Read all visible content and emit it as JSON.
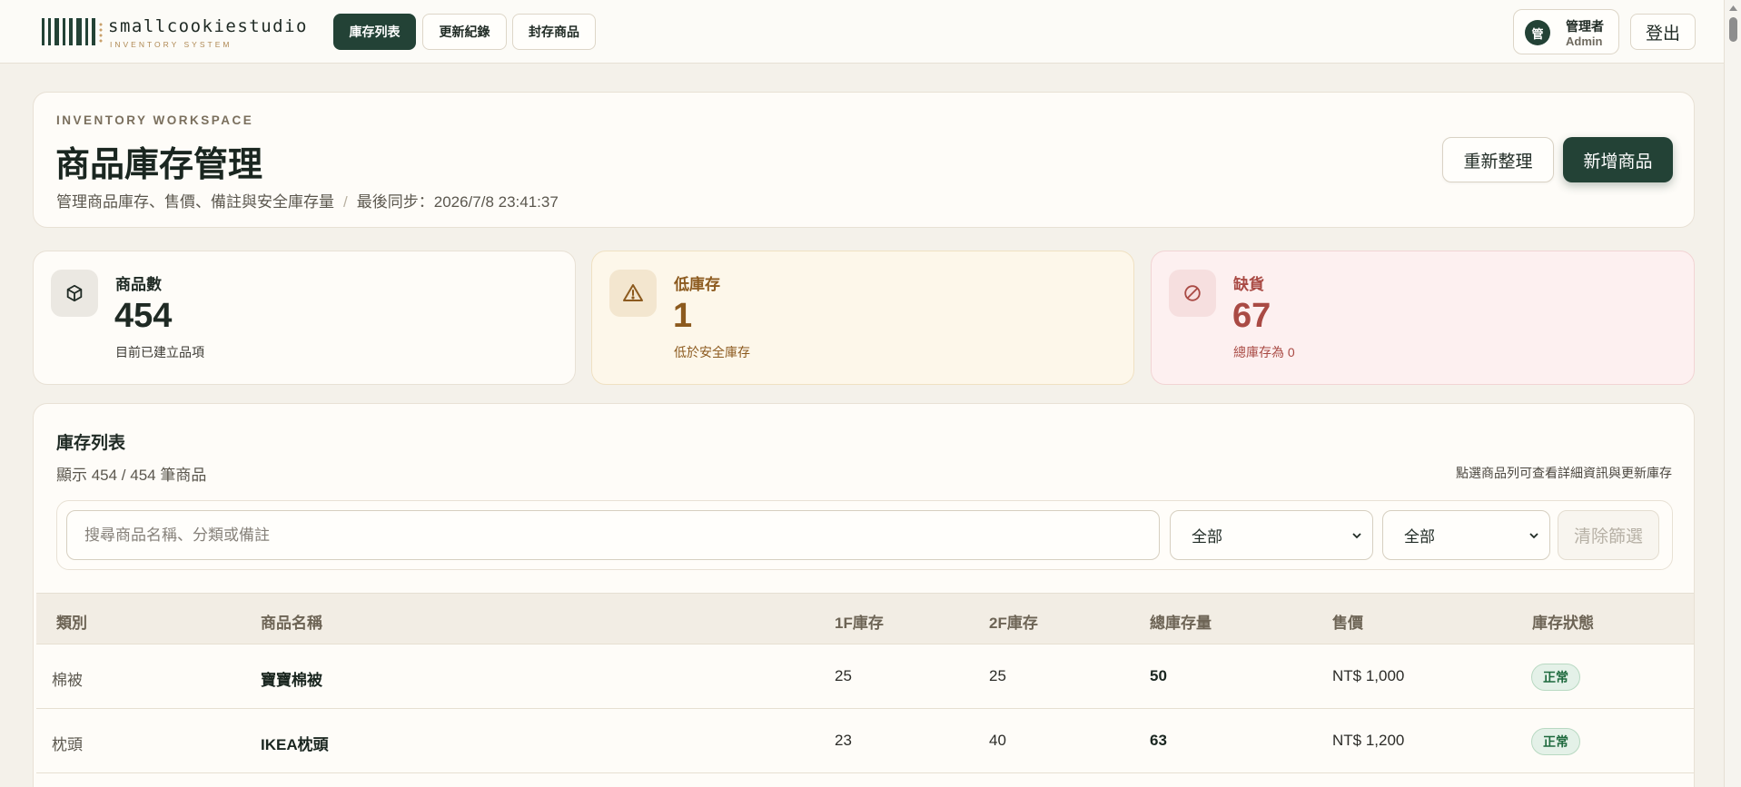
{
  "brand": {
    "name": "smallcookiestudio",
    "subtitle": "INVENTORY SYSTEM"
  },
  "nav": {
    "tabs": [
      {
        "label": "庫存列表",
        "active": true
      },
      {
        "label": "更新紀錄",
        "active": false
      },
      {
        "label": "封存商品",
        "active": false
      }
    ]
  },
  "user": {
    "avatar": "管",
    "role": "管理者",
    "name": "Admin",
    "logout_label": "登出"
  },
  "header": {
    "eyebrow": "INVENTORY WORKSPACE",
    "title": "商品庫存管理",
    "description": "管理商品庫存、售價、備註與安全庫存量",
    "separator": "/",
    "last_sync": "最後同步：2026/7/8 23:41:37",
    "refresh_label": "重新整理",
    "add_label": "新增商品"
  },
  "stats": [
    {
      "label": "商品數",
      "value": "454",
      "sub": "目前已建立品項",
      "icon": "box-icon"
    },
    {
      "label": "低庫存",
      "value": "1",
      "sub": "低於安全庫存",
      "icon": "warning-icon"
    },
    {
      "label": "缺貨",
      "value": "67",
      "sub": "總庫存為 0",
      "icon": "ban-icon"
    }
  ],
  "list": {
    "title": "庫存列表",
    "count": "顯示 454 / 454 筆商品",
    "hint": "點選商品列可查看詳細資訊與更新庫存",
    "search_placeholder": "搜尋商品名稱、分類或備註",
    "filter_category": "全部",
    "filter_status": "全部",
    "clear_label": "清除篩選",
    "columns": [
      "類別",
      "商品名稱",
      "1F庫存",
      "2F庫存",
      "總庫存量",
      "售價",
      "庫存狀態"
    ],
    "rows": [
      {
        "category": "棉被",
        "name": "寶寶棉被",
        "stock_1f": "25",
        "stock_2f": "25",
        "total": "50",
        "price": "NT$ 1,000",
        "status": "正常"
      },
      {
        "category": "枕頭",
        "name": "IKEA枕頭",
        "stock_1f": "23",
        "stock_2f": "40",
        "total": "63",
        "price": "NT$ 1,200",
        "status": "正常"
      }
    ]
  },
  "colors": {
    "primary": "#234236",
    "background": "#f4f1ea",
    "warning": "#8c5a1e",
    "danger": "#a94a44",
    "success": "#1f6a3e"
  }
}
